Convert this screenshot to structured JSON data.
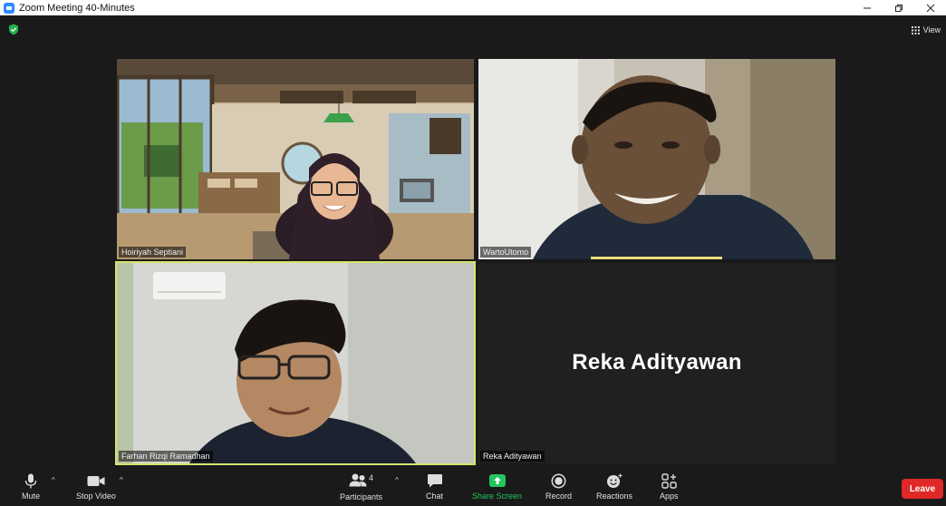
{
  "window": {
    "title": "Zoom Meeting 40-Minutes"
  },
  "meeting": {
    "view_label": "View",
    "encryption_icon": "shield-check-icon",
    "active_speaker_color": "#e7da7a",
    "pinned_border_color": "#d7e36b"
  },
  "participants": [
    {
      "name": "Hoiriyah Septiani",
      "video": "on"
    },
    {
      "name": "WartoUtomo",
      "video": "on",
      "active_speaker": true
    },
    {
      "name": "Farhan Rizqi Ramadhan",
      "video": "on",
      "highlighted": true
    },
    {
      "name": "Reka Adityawan",
      "display_name": "Reka Adityawan",
      "video": "off"
    }
  ],
  "toolbar": {
    "mute": "Mute",
    "stop_video": "Stop Video",
    "participants": "Participants",
    "participants_count": "4",
    "chat": "Chat",
    "share_screen": "Share Screen",
    "share_screen_color": "#22c55e",
    "record": "Record",
    "reactions": "Reactions",
    "apps": "Apps",
    "leave": "Leave",
    "leave_color": "#e02828"
  }
}
